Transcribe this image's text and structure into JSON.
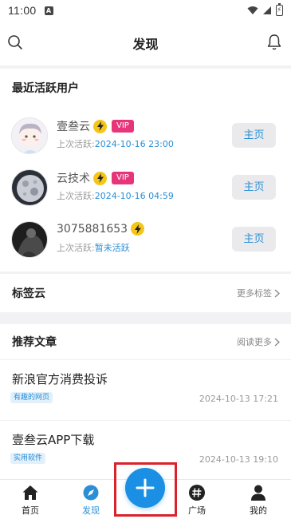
{
  "status_bar": {
    "time": "11:00",
    "notification_badge": "A"
  },
  "header": {
    "title": "发现"
  },
  "active_users": {
    "title": "最近活跃用户",
    "last_active_label": "上次活跃:",
    "users": [
      {
        "name": "壹叁云",
        "vip": "VIP",
        "last_active": "2024-10-16 23:00",
        "button": "主页"
      },
      {
        "name": "云技术",
        "vip": "VIP",
        "last_active": "2024-10-16 04:59",
        "button": "主页"
      },
      {
        "name": "3075881653",
        "last_active": "暂未活跃",
        "button": "主页"
      }
    ]
  },
  "tag_cloud": {
    "title": "标签云",
    "more": "更多标签"
  },
  "articles": {
    "title": "推荐文章",
    "more": "阅读更多",
    "items": [
      {
        "title": "新浪官方消费投诉",
        "tag": "有趣的网页",
        "date": "2024-10-13 17:21"
      },
      {
        "title": "壹叁云APP下载",
        "tag": "实用软件",
        "date": "2024-10-13 19:10"
      }
    ]
  },
  "tab_bar": {
    "items": [
      {
        "label": "首页",
        "icon": "home-icon"
      },
      {
        "label": "发现",
        "icon": "compass-icon",
        "active": true
      },
      {
        "label": "广场",
        "icon": "hash-icon"
      },
      {
        "label": "我的",
        "icon": "profile-icon"
      }
    ],
    "fab_icon": "plus-icon"
  },
  "colors": {
    "accent": "#2a8fd6",
    "fab": "#1a8fe3",
    "vip": "#e6357a",
    "highlight": "#d9222a",
    "bolt": "#f5c518"
  }
}
